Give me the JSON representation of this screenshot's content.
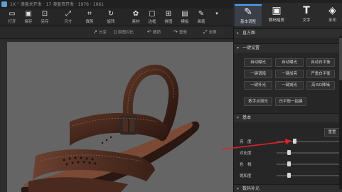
{
  "titlebar": {
    "title": "1X ° 澳盖关开发 · 17 澳盖资开发 · 1976 · 1961"
  },
  "toolbar": {
    "buttons": [
      {
        "label": "打开",
        "icon": "folder-open-icon"
      },
      {
        "label": "保存",
        "icon": "save-icon"
      },
      {
        "label": "另存",
        "icon": "save-as-icon"
      },
      {
        "label": "尺寸",
        "icon": "resize-icon"
      },
      {
        "label": "裁剪",
        "icon": "crop-icon"
      },
      {
        "label": "旋转",
        "icon": "rotate-icon"
      },
      {
        "label": "素材",
        "icon": "material-icon"
      },
      {
        "label": "边框",
        "icon": "border-icon"
      },
      {
        "label": "拼图",
        "icon": "collage-icon"
      },
      {
        "label": "模板",
        "icon": "template-icon"
      },
      {
        "label": "画笔",
        "icon": "brush-icon"
      }
    ]
  },
  "right_tabs": [
    {
      "label": "基本调整",
      "icon": "edit-icon",
      "active": true
    },
    {
      "label": "数码暗房",
      "icon": "darkroom-icon",
      "active": false
    },
    {
      "label": "文字",
      "icon": "text-icon",
      "active": false
    },
    {
      "label": "水印",
      "icon": "watermark-icon",
      "active": false
    }
  ],
  "subbar": {
    "items": [
      "分享",
      "原图对比",
      "撤销",
      "重做",
      "全屏"
    ]
  },
  "panel": {
    "histogram_label": "直方图",
    "one_click_label": "一键设置",
    "one_click_buttons": [
      "自动曝光",
      "自动曝光",
      "自动白平衡",
      "一键调暗",
      "一键加亮",
      "严重白平衡",
      "一键补光",
      "一键减光",
      "高ISO降噪"
    ],
    "extra_buttons": [
      "数字点测光",
      "白平衡一指键"
    ],
    "basic_label": "基本",
    "reset_label": "重置",
    "sliders": [
      {
        "label": "亮　度",
        "value": 0.65
      },
      {
        "label": "对比度",
        "value": 0.55
      },
      {
        "label": "色　相",
        "value": 0.55
      },
      {
        "label": "饱和度",
        "value": 0.55
      }
    ],
    "bottom_label": "数码补光"
  }
}
